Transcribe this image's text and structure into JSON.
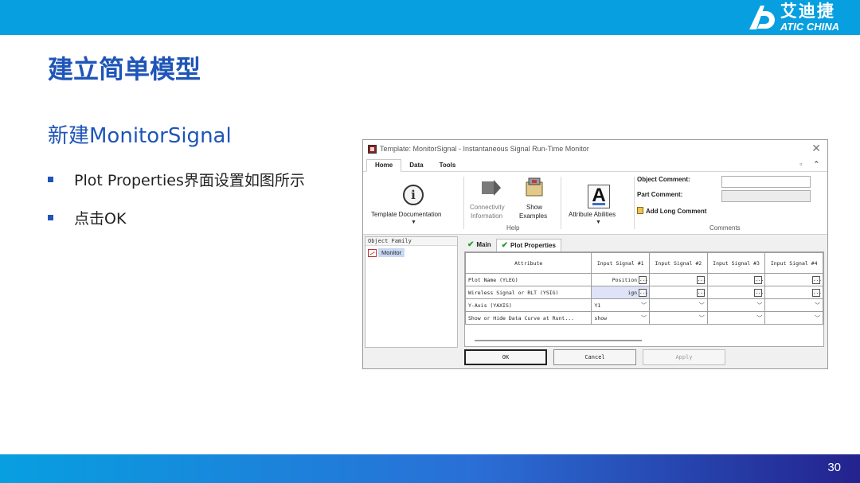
{
  "header": {
    "logo_cn": "艾迪捷",
    "logo_en": "ATIC CHINA",
    "accent_color": "#079fe0"
  },
  "slide": {
    "title": "建立简单模型",
    "subtitle": "新建MonitorSignal",
    "bullets": [
      "Plot Properties界面设置如图所示",
      "点击OK"
    ],
    "page_number": "30",
    "title_color": "#1f55b8"
  },
  "dialog": {
    "title": "Template: MonitorSignal - Instantaneous Signal Run-Time Monitor",
    "ribbon_tabs": [
      "Home",
      "Data",
      "Tools"
    ],
    "ribbon": {
      "template_doc_label": "Template Documentation",
      "connectivity_label_1": "Connectivity",
      "connectivity_label_2": "Information",
      "show_examples_1": "Show",
      "show_examples_2": "Examples",
      "help_group": "Help",
      "attribute_abilities_label": "Attribute Abilities",
      "object_comment_label": "Object Comment:",
      "part_comment_label": "Part Comment:",
      "add_long_comment_label": "Add Long Comment",
      "comments_group": "Comments"
    },
    "object_family": {
      "header": "Object Family",
      "items": [
        "Monitor"
      ]
    },
    "property_tabs": [
      "Main",
      "Plot Properties"
    ],
    "grid": {
      "columns": [
        "Attribute",
        "Input Signal #1",
        "Input Signal #2",
        "Input Signal #3",
        "Input Signal #4"
      ],
      "rows": [
        {
          "attr": "Plot Name (YLEG)",
          "v1": "Position"
        },
        {
          "attr": "Wireless Signal or RLT (YSIG)",
          "v1": "ign"
        },
        {
          "attr": "Y-Axis (YAXIS)",
          "v1": "Y1"
        },
        {
          "attr": "Show or Hide Data Curve at Runt...",
          "v1": "show"
        }
      ]
    },
    "buttons": {
      "ok": "OK",
      "cancel": "Cancel",
      "apply": "Apply"
    }
  }
}
